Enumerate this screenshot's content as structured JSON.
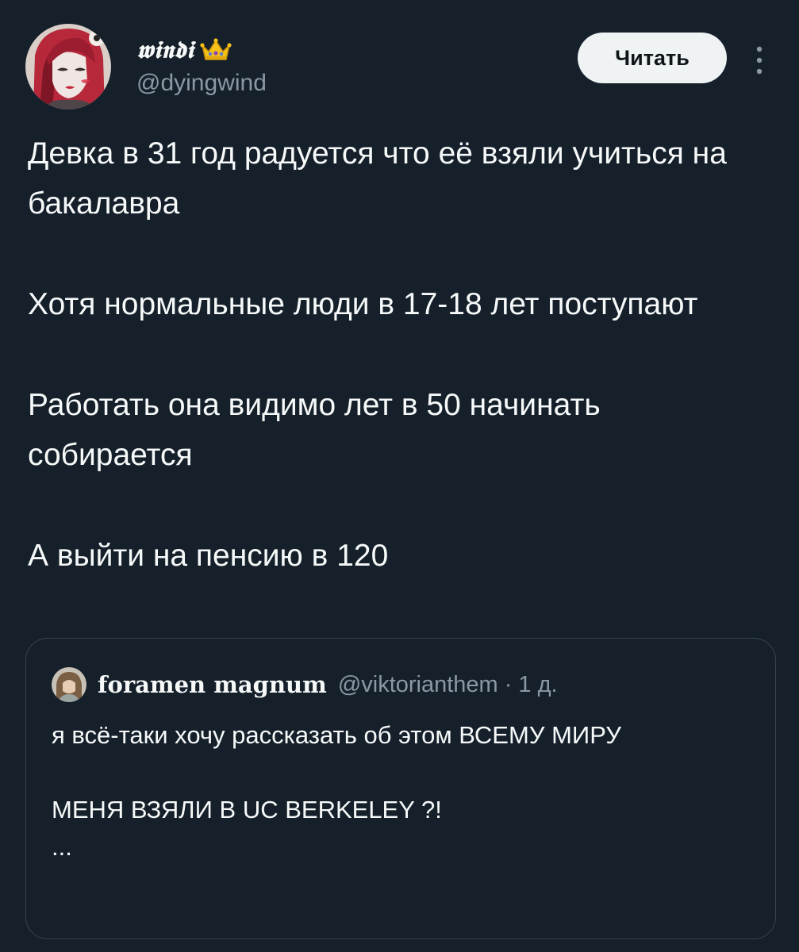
{
  "author": {
    "display_name": "𝖜𝖎𝖓𝖉𝖎",
    "handle": "@dyingwind",
    "avatar_icon": "avatar-girl-red-hair",
    "badge_icon": "crown-icon"
  },
  "actions": {
    "follow_label": "Читать",
    "more_icon": "more-vertical-icon"
  },
  "tweet": {
    "paragraphs": [
      "Девка в 31 год радуется что её взяли учиться на бакалавра",
      "Хотя нормальные люди в 17-18 лет поступают",
      "Работать она видимо лет в 50 начинать собирается",
      "А выйти на пенсию в 120"
    ]
  },
  "quote": {
    "author_name": "foramen magnum",
    "handle": "@viktorianthem",
    "separator": "·",
    "time": "1 д.",
    "paragraphs": [
      "я всё-таки хочу рассказать об этом ВСЕМУ МИРУ",
      "МЕНЯ ВЗЯЛИ В UC BERKELEY ?!",
      "..."
    ]
  },
  "colors": {
    "background": "#15202b",
    "text_primary": "#f7f9f9",
    "text_secondary": "#8b98a5",
    "border": "#38444d",
    "button_bg": "#eff3f4"
  }
}
